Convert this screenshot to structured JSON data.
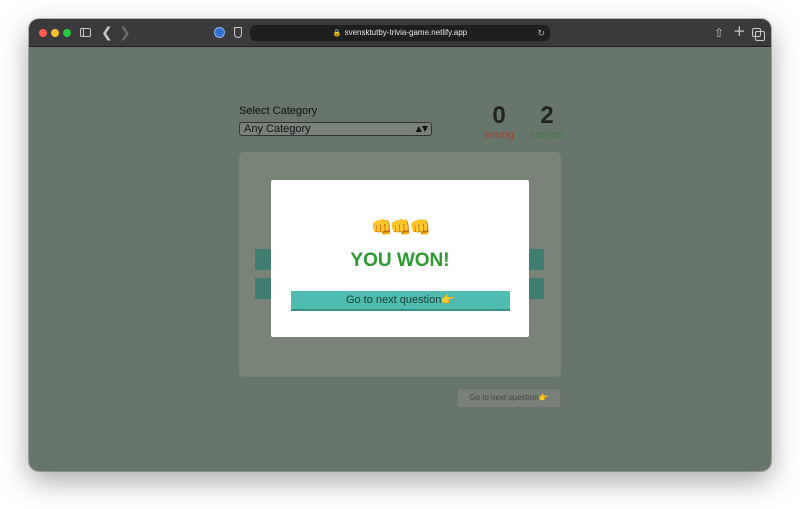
{
  "browser": {
    "url": "svensktutby-trivia-game.netlify.app",
    "icons": [
      "sidebar-icon",
      "back-icon",
      "forward-icon",
      "globe-icon",
      "shield-icon",
      "lock-icon",
      "reload-icon",
      "share-icon",
      "plus-icon",
      "tabs-icon"
    ]
  },
  "category": {
    "label": "Select Category",
    "selected": "Any Category"
  },
  "score": {
    "wrong_count": "0",
    "wrong_label": "wrong",
    "correct_count": "2",
    "correct_label": "correct"
  },
  "background_button": {
    "label": "Go to next question👉"
  },
  "modal": {
    "emojis": "👊👊👊",
    "title": "YOU WON!",
    "button_label": "Go to next question👉"
  },
  "colors": {
    "page_overlay": "#67766a",
    "win_text": "#2b9a2f",
    "modal_button": "#4fbcb0",
    "wrong": "#9e4434",
    "correct": "#3e7a44"
  }
}
